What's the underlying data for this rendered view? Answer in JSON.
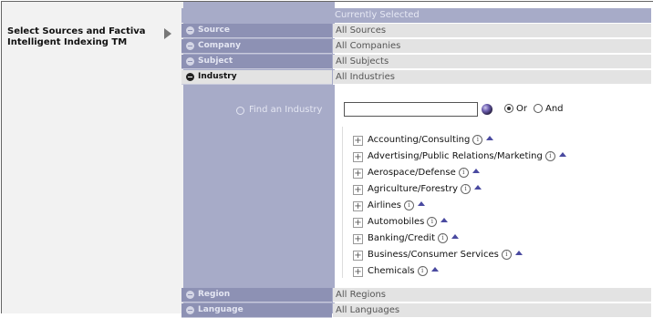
{
  "sidebar": {
    "label": "Select Sources and Factiva Intelligent Indexing TM"
  },
  "header": {
    "currently_selected": "Currently Selected"
  },
  "categories": [
    {
      "label": "Source",
      "value": "All Sources"
    },
    {
      "label": "Company",
      "value": "All Companies"
    },
    {
      "label": "Subject",
      "value": "All Subjects"
    },
    {
      "label": "Industry",
      "value": "All Industries"
    },
    {
      "label": "Region",
      "value": "All Regions"
    },
    {
      "label": "Language",
      "value": "All Languages"
    }
  ],
  "industry_search": {
    "label": "Find an Industry",
    "input_value": "",
    "or_label": "Or",
    "and_label": "And",
    "selected_operator": "Or"
  },
  "industries": [
    "Accounting/Consulting",
    "Advertising/Public Relations/Marketing",
    "Aerospace/Defense",
    "Agriculture/Forestry",
    "Airlines",
    "Automobiles",
    "Banking/Credit",
    "Business/Consumer Services",
    "Chemicals"
  ],
  "icons": {
    "collapsed": "plus-circle-icon",
    "expanded": "minus-circle-icon",
    "expand_node": "plus-box-icon",
    "info": "info-icon",
    "move_up": "triangle-up-icon",
    "search": "magnifier-icon",
    "go": "go-orb-icon"
  }
}
